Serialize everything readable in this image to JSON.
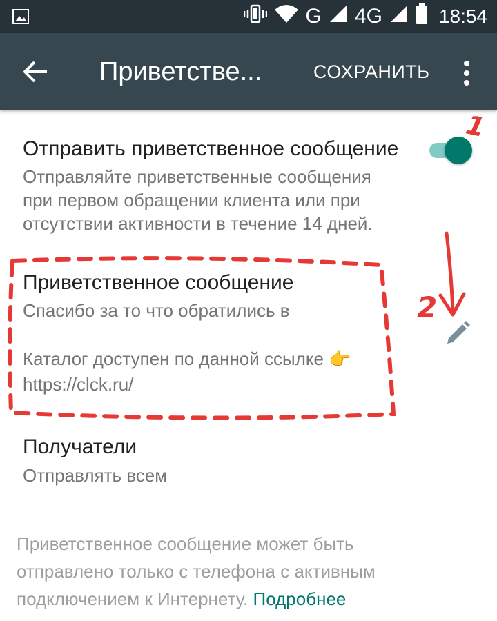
{
  "status_bar": {
    "network_label": "G",
    "network_4g_label": "4G",
    "time": "18:54",
    "icons": [
      "image-icon",
      "vibrate-icon",
      "wifi-icon",
      "signal-icon",
      "battery-icon"
    ]
  },
  "toolbar": {
    "title": "Приветстве...",
    "save_label": "СОХРАНИТЬ",
    "icons": [
      "back-arrow-icon",
      "more-vert-icon"
    ]
  },
  "send_greeting": {
    "title": "Отправить приветственное сообщение",
    "description_lines": [
      "Отправляйте приветственные сообщения",
      "при первом обращении клиента или при",
      "отсутствии активности в течение 14 дней."
    ],
    "enabled": true
  },
  "greeting_message": {
    "title": "Приветственное сообщение",
    "body_line1": "Спасибо за то что обратились в",
    "body_line2": "Каталог доступен по данной ссылке",
    "body_emoji": "👉",
    "body_line3": "https://clck.ru/"
  },
  "recipients": {
    "title": "Получатели",
    "value": "Отправлять всем"
  },
  "footer": {
    "text_line1": "Приветственное сообщение может быть",
    "text_line2": "отправлено только с телефона с активным",
    "text_line3": "подключением к Интернету.",
    "link": "Подробнее"
  },
  "annotations": {
    "marker_1": "1",
    "marker_2": "2",
    "color": "#e53935"
  },
  "colors": {
    "status_bar": "#263238",
    "toolbar": "#37474f",
    "accent": "#00796b",
    "accent_light": "#80cbc4"
  }
}
